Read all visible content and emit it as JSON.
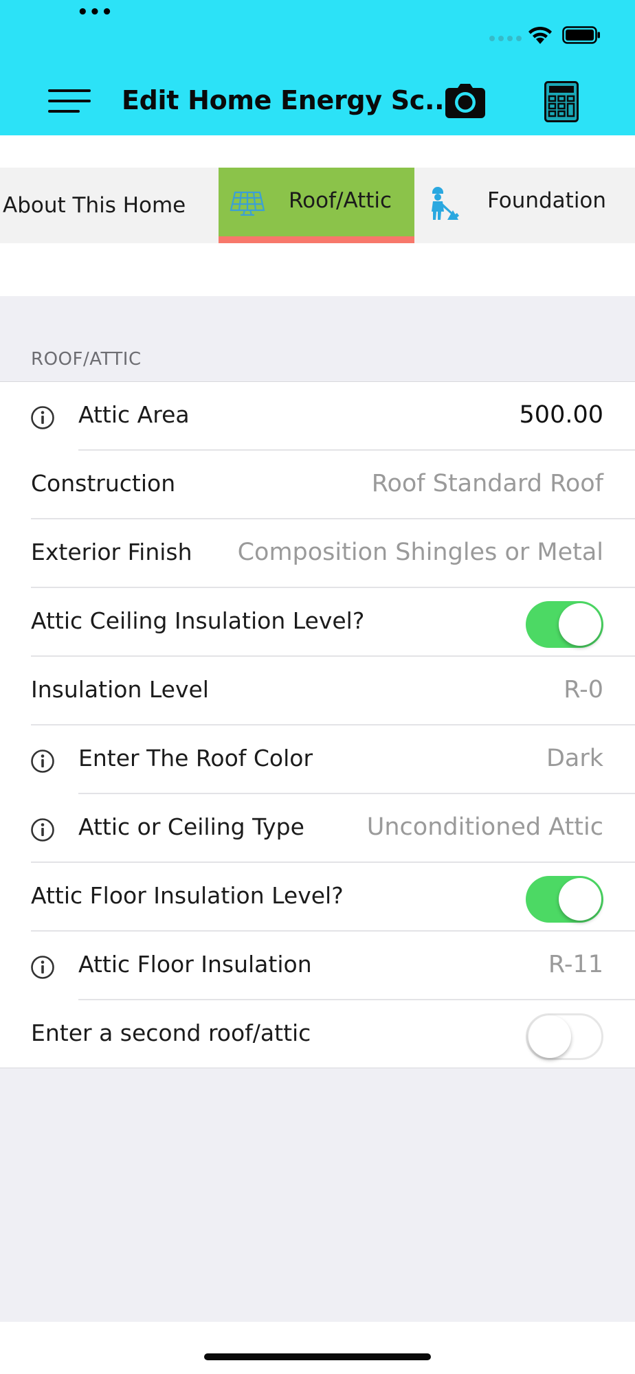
{
  "status_bar": {
    "dots": "•••"
  },
  "header": {
    "title": "Edit Home Energy Sc...",
    "menu_icon": "hamburger-menu-icon",
    "camera_icon": "camera-icon",
    "calculator_icon": "calculator-icon",
    "background_color": "#2ce2f7"
  },
  "tabs": [
    {
      "label": "About This Home",
      "icon": "",
      "active": false
    },
    {
      "label": "Roof/Attic",
      "icon": "solar-panel-icon",
      "active": true
    },
    {
      "label": "Foundation",
      "icon": "construction-worker-icon",
      "active": false
    }
  ],
  "tab_colors": {
    "active_bg": "#8bc34a",
    "active_underline": "#f7786b"
  },
  "section": {
    "header": "ROOF/ATTIC",
    "rows": [
      {
        "label": "Attic Area",
        "value": "500.00",
        "info": true
      },
      {
        "label": "Construction",
        "value": "Roof Standard Roof",
        "info": false
      },
      {
        "label": "Exterior Finish",
        "value": "Composition Shingles or Metal",
        "info": false
      },
      {
        "label": "Attic Ceiling Insulation Level?",
        "toggle": true,
        "on": true
      },
      {
        "label": "Insulation Level",
        "value": "R-0",
        "info": false
      },
      {
        "label": "Enter The Roof Color",
        "value": "Dark",
        "info": true
      },
      {
        "label": "Attic or Ceiling Type",
        "value": "Unconditioned Attic",
        "info": true
      },
      {
        "label": "Attic Floor Insulation Level?",
        "toggle": true,
        "on": true
      },
      {
        "label": "Attic Floor Insulation",
        "value": "R-11",
        "info": true
      },
      {
        "label": "Enter a second roof/attic",
        "toggle": true,
        "on": false
      }
    ]
  },
  "colors": {
    "toggle_on": "#4cd964",
    "value_text": "#9a9a9a"
  }
}
